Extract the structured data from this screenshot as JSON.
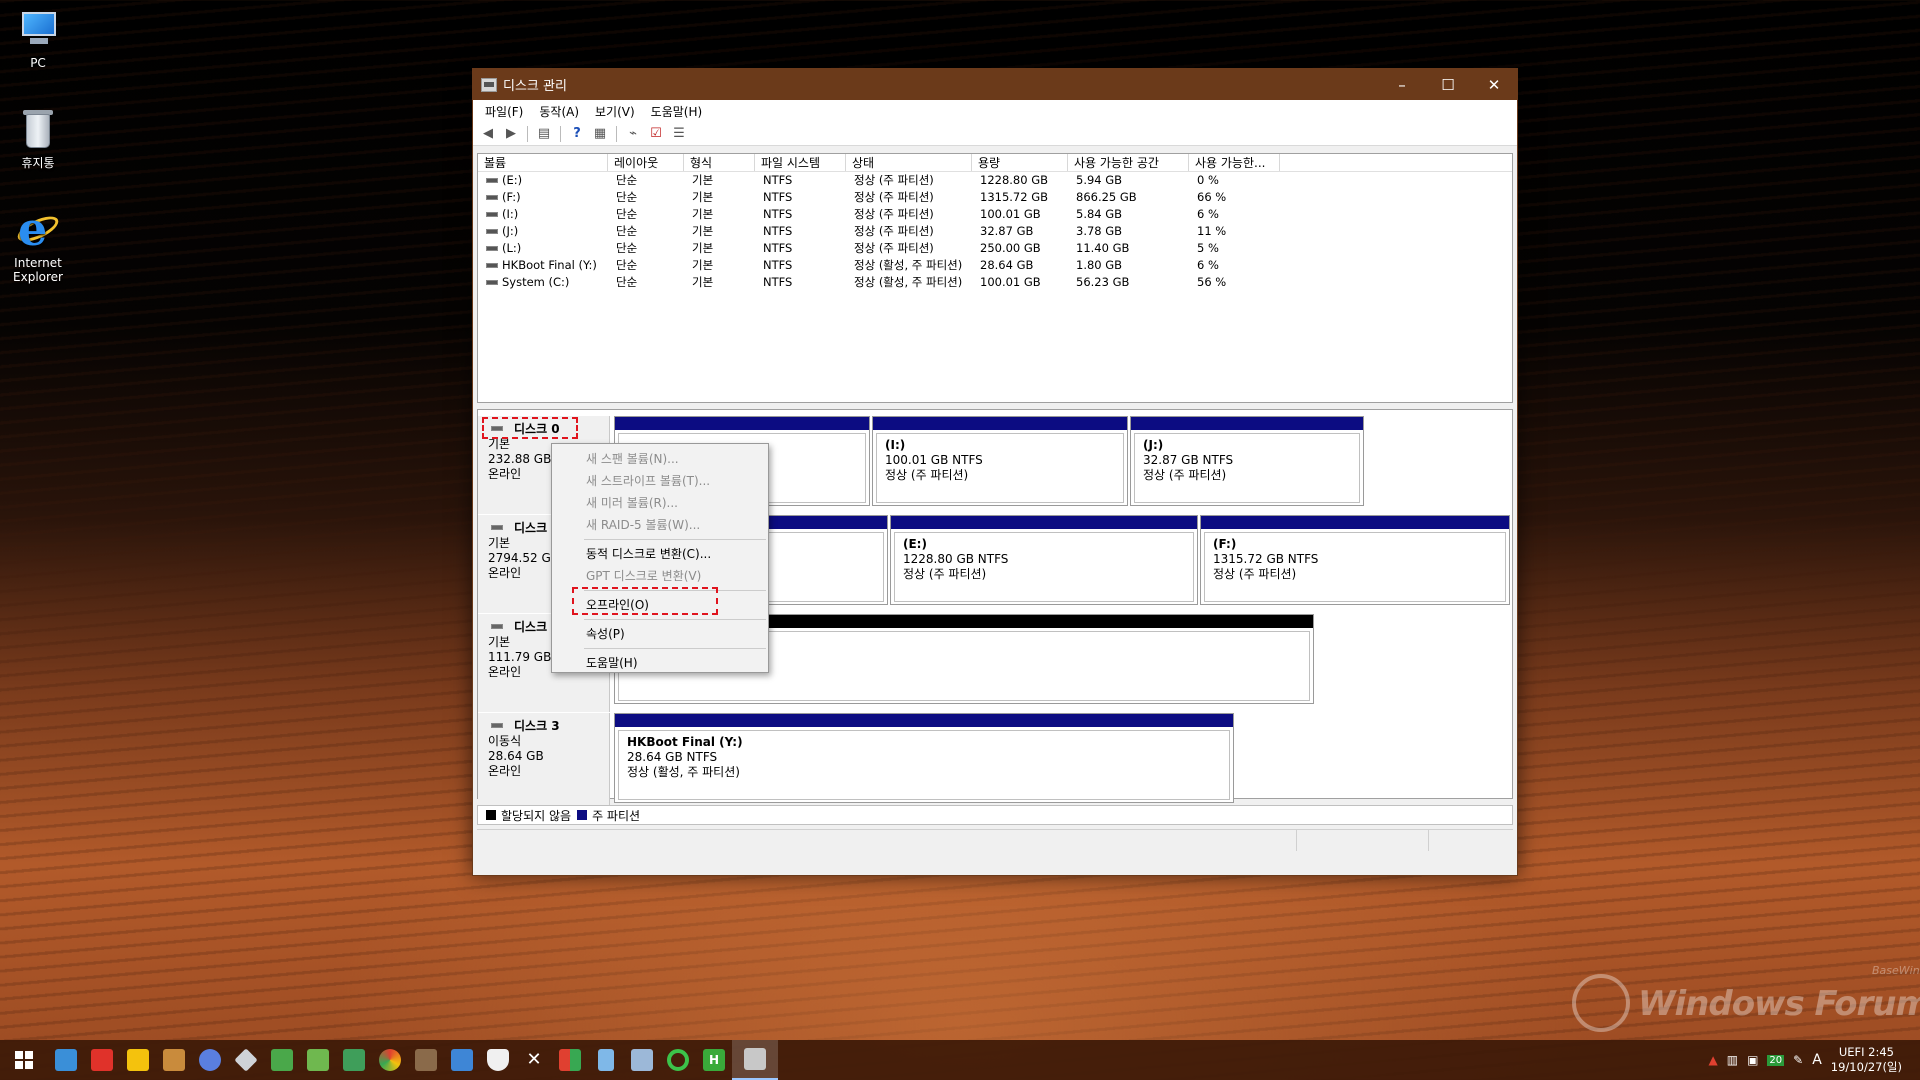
{
  "desktop": {
    "icons": [
      {
        "label": "PC"
      },
      {
        "label": "휴지통"
      },
      {
        "label": "Internet Explorer"
      }
    ]
  },
  "window": {
    "title": "디스크 관리",
    "controls": {
      "minimize": "–",
      "maximize": "☐",
      "close": "✕"
    }
  },
  "menu": [
    "파일(F)",
    "동작(A)",
    "보기(V)",
    "도움말(H)"
  ],
  "toolbar_icons": [
    "back-arrow-icon",
    "forward-arrow-icon",
    "console-tree-icon",
    "help-icon",
    "properties-icon",
    "connect-icon",
    "check-icon",
    "list-icon"
  ],
  "volume_list": {
    "columns": [
      "볼륨",
      "레이아웃",
      "형식",
      "파일 시스템",
      "상태",
      "용량",
      "사용 가능한 공간",
      "사용 가능한..."
    ],
    "rows": [
      [
        "(E:)",
        "단순",
        "기본",
        "NTFS",
        "정상 (주 파티션)",
        "1228.80 GB",
        "5.94 GB",
        "0 %"
      ],
      [
        "(F:)",
        "단순",
        "기본",
        "NTFS",
        "정상 (주 파티션)",
        "1315.72 GB",
        "866.25 GB",
        "66 %"
      ],
      [
        "(I:)",
        "단순",
        "기본",
        "NTFS",
        "정상 (주 파티션)",
        "100.01 GB",
        "5.84 GB",
        "6 %"
      ],
      [
        "(J:)",
        "단순",
        "기본",
        "NTFS",
        "정상 (주 파티션)",
        "32.87 GB",
        "3.78 GB",
        "11 %"
      ],
      [
        "(L:)",
        "단순",
        "기본",
        "NTFS",
        "정상 (주 파티션)",
        "250.00 GB",
        "11.40 GB",
        "5 %"
      ],
      [
        "HKBoot Final (Y:)",
        "단순",
        "기본",
        "NTFS",
        "정상 (활성, 주 파티션)",
        "28.64 GB",
        "1.80 GB",
        "6 %"
      ],
      [
        "System (C:)",
        "단순",
        "기본",
        "NTFS",
        "정상 (활성, 주 파티션)",
        "100.01 GB",
        "56.23 GB",
        "56 %"
      ]
    ]
  },
  "disks": [
    {
      "name": "디스크 0",
      "type": "기본",
      "size": "232.88 GB",
      "status": "온라인",
      "partitions": [
        {
          "name": "",
          "size": "",
          "status": ""
        },
        {
          "name": "(I:)",
          "size": "100.01 GB NTFS",
          "status": "정상 (주 파티션)"
        },
        {
          "name": "(J:)",
          "size": "32.87 GB NTFS",
          "status": "정상 (주 파티션)"
        }
      ]
    },
    {
      "name": "디스크",
      "type": "기본",
      "size": "2794.52 GB",
      "status": "온라인",
      "partitions": [
        {
          "name": "",
          "size": "",
          "status": ""
        },
        {
          "name": "(E:)",
          "size": "1228.80 GB NTFS",
          "status": "정상 (주 파티션)"
        },
        {
          "name": "(F:)",
          "size": "1315.72 GB NTFS",
          "status": "정상 (주 파티션)"
        }
      ]
    },
    {
      "name": "디스크",
      "type": "기본",
      "size": "111.79 GB",
      "status": "온라인",
      "partitions": [
        {
          "name": "",
          "size": "",
          "status": "할당되지 않음"
        }
      ]
    },
    {
      "name": "디스크 3",
      "type": "이동식",
      "size": "28.64 GB",
      "status": "온라인",
      "partitions": [
        {
          "name": "HKBoot Final  (Y:)",
          "size": "28.64 GB NTFS",
          "status": "정상 (활성, 주 파티션)"
        }
      ]
    }
  ],
  "legend": {
    "unallocated": "할당되지 않음",
    "primary": "주 파티션"
  },
  "context_menu": {
    "items": [
      {
        "label": "새 스팬 볼륨(N)...",
        "enabled": false
      },
      {
        "label": "새 스트라이프 볼륨(T)...",
        "enabled": false
      },
      {
        "label": "새 미러 볼륨(R)...",
        "enabled": false
      },
      {
        "label": "새 RAID-5 볼륨(W)...",
        "enabled": false
      },
      {
        "label": "동적 디스크로 변환(C)...",
        "enabled": true
      },
      {
        "label": "GPT 디스크로 변환(V)",
        "enabled": false
      },
      {
        "label": "오프라인(O)",
        "enabled": true
      },
      {
        "label": "속성(P)",
        "enabled": true
      },
      {
        "label": "도움말(H)",
        "enabled": true
      }
    ]
  },
  "taskbar": {
    "tray": {
      "lang": "A",
      "badge": "20",
      "clock_line1": "UEFI  2:45",
      "clock_line2": "19/10/27(일)"
    }
  },
  "watermark": {
    "brand": "Windows Forum",
    "small": "BaseWindows Community"
  },
  "colors": {
    "primary_partition": "#0c0c82",
    "unallocated": "#000000",
    "highlight": "#e0141e",
    "titlebar": "#6b3a1a"
  }
}
